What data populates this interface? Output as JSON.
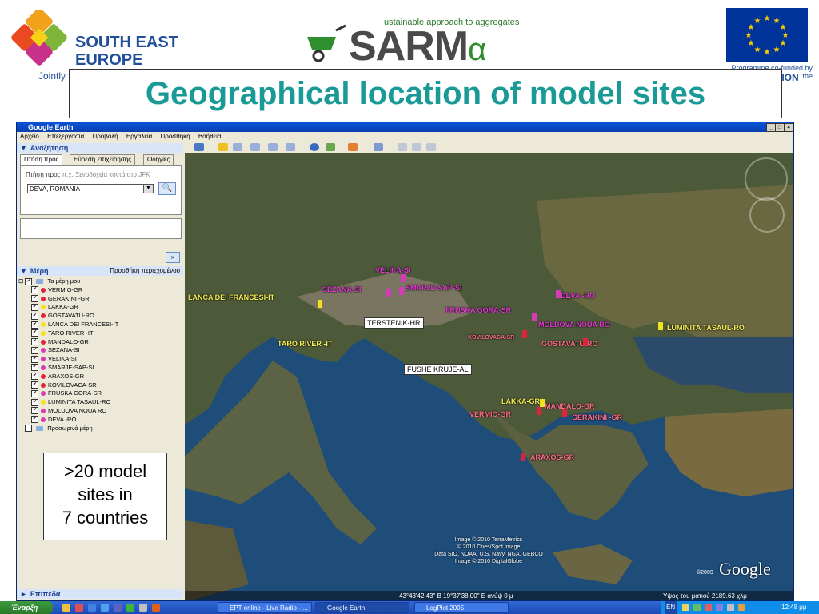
{
  "header": {
    "see_logo": {
      "line1": "SOUTH EAST",
      "line2": "EUROPE",
      "tagline": "Jointly fo"
    },
    "sarma_logo": {
      "tagline": "ustainable approach to aggregates",
      "word_main": "SARM",
      "word_small": "α"
    },
    "eu_caption": "Programme co-funded by the",
    "eu_union": "UNION",
    "title": "Geographical location of model sites"
  },
  "window": {
    "title": "Google Earth",
    "buttons": [
      "_",
      "□",
      "×"
    ],
    "menu": [
      "Αρχείο",
      "Επεξεργασία",
      "Προβολή",
      "Εργαλεία",
      "Προσθήκη",
      "Βοήθεια"
    ]
  },
  "sidebar": {
    "search_header": "Αναζήτηση",
    "tabs": [
      "Πτήση προς",
      "Εύρεση επιχείρησης",
      "Οδηγίες"
    ],
    "fly_label": "Πτήση προς",
    "fly_hint": "π.χ. Ξενοδοχεία κοντά στο JFK",
    "fly_value": "DEVA, ROMANIA",
    "close_label": "×",
    "places_header": "Μέρη",
    "add_content": "Προσθήκη περιεχομένου",
    "root_label": "Τα μέρη μου",
    "places": [
      {
        "label": "VERMIO-GR",
        "color": "#e0223a"
      },
      {
        "label": "GERAKINI -GR",
        "color": "#e0223a"
      },
      {
        "label": "LAKKA-GR",
        "color": "#f2e21b"
      },
      {
        "label": "GOSTAVATU-RO",
        "color": "#e0223a"
      },
      {
        "label": "LANCA DEI FRANCESI-IT",
        "color": "#f2e21b"
      },
      {
        "label": "TARO RIVER -IT",
        "color": "#f2e21b"
      },
      {
        "label": "MANDALO-GR",
        "color": "#e0223a"
      },
      {
        "label": "SEZANA-SI",
        "color": "#d63ab8"
      },
      {
        "label": "VELIKA-SI",
        "color": "#d63ab8"
      },
      {
        "label": "SMARJE-SAP-SI",
        "color": "#d63ab8"
      },
      {
        "label": "ARAXOS-GR",
        "color": "#e0223a"
      },
      {
        "label": "KOVILOVACA-SR",
        "color": "#e0223a"
      },
      {
        "label": "FRUSKA GORA-SR",
        "color": "#d63ab8"
      },
      {
        "label": "LUMINITA TASAUL-RO",
        "color": "#f2e21b"
      },
      {
        "label": "MOLDOVA NOUA RO",
        "color": "#d63ab8"
      },
      {
        "label": "DEVA -RO",
        "color": "#d63ab8"
      }
    ],
    "temp_label": "Προσωρινά μέρη",
    "layers_header": "Επίπεδα"
  },
  "map": {
    "labels": {
      "lanca": "LANCA DEI FRANCESI-IT",
      "taro": "TARO RIVER -IT",
      "sezana": "SEZANA-SI",
      "velika": "VELIKA-SI",
      "smarje": "SMARJE-SAP-SI",
      "deva": "DEVA -RO",
      "fruska": "FRUSKA GORA-SR",
      "moldova": "MOLDOVA NOUA RO",
      "kovilovaca": "KOVILOVACA-SR",
      "gostavatu": "GOSTAVATU-RO",
      "luminita": "LUMINITA TASAUL-RO",
      "lakka": "LAKKA-GR",
      "mandalo": "MANDALO-GR",
      "vermio": "VERMIO-GR",
      "gerakini": "GERAKINI -GR",
      "araxos": "ARAXOS-GR"
    },
    "terstenik": "TERSTENIK-HR",
    "fushe": "FUSHE KRUJE-AL",
    "credits": [
      "Image © 2010 TerraMetrics",
      "© 2010 Cnes/Spot Image",
      "Data SIO, NOAA, U.S. Navy, NGA, GEBCO",
      "Image © 2010 DigitalGlobe"
    ],
    "google": "Google",
    "year": "©2009",
    "coords": "43°43'42.43\" B    19°37'38.00\" E    ανύψ    0 μ",
    "eye_alt": "Υψος του ματιού  2189.63 χλμ"
  },
  "note": {
    "line1": ">20 model",
    "line2": "sites in",
    "line3": "7 countries"
  },
  "taskbar": {
    "start": "Έναρξη",
    "tasks": [
      "EPT online - Live Radio - ...",
      "Google Earth",
      "LogPlot 2005"
    ],
    "lang": "EN",
    "clock": "12:48 μμ"
  }
}
